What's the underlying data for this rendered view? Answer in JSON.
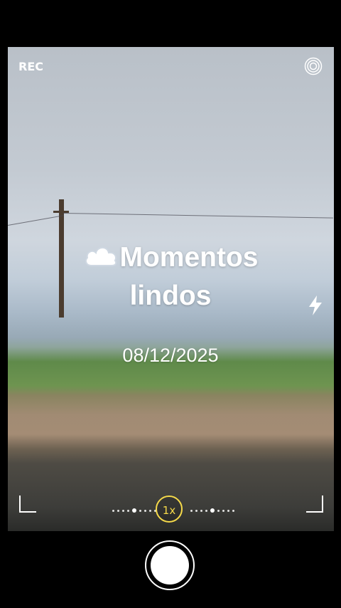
{
  "camera": {
    "rec_label": "REC",
    "zoom_label": "1x",
    "icons": {
      "settings": "settings-rings-icon",
      "flash": "flash-icon",
      "shutter": "shutter-button"
    }
  },
  "overlay": {
    "title_line1": "Momentos",
    "title_line2": "lindos",
    "date": "08/12/2025",
    "emoji": "cloud-icon"
  },
  "colors": {
    "accent_zoom": "#f5d94a"
  }
}
